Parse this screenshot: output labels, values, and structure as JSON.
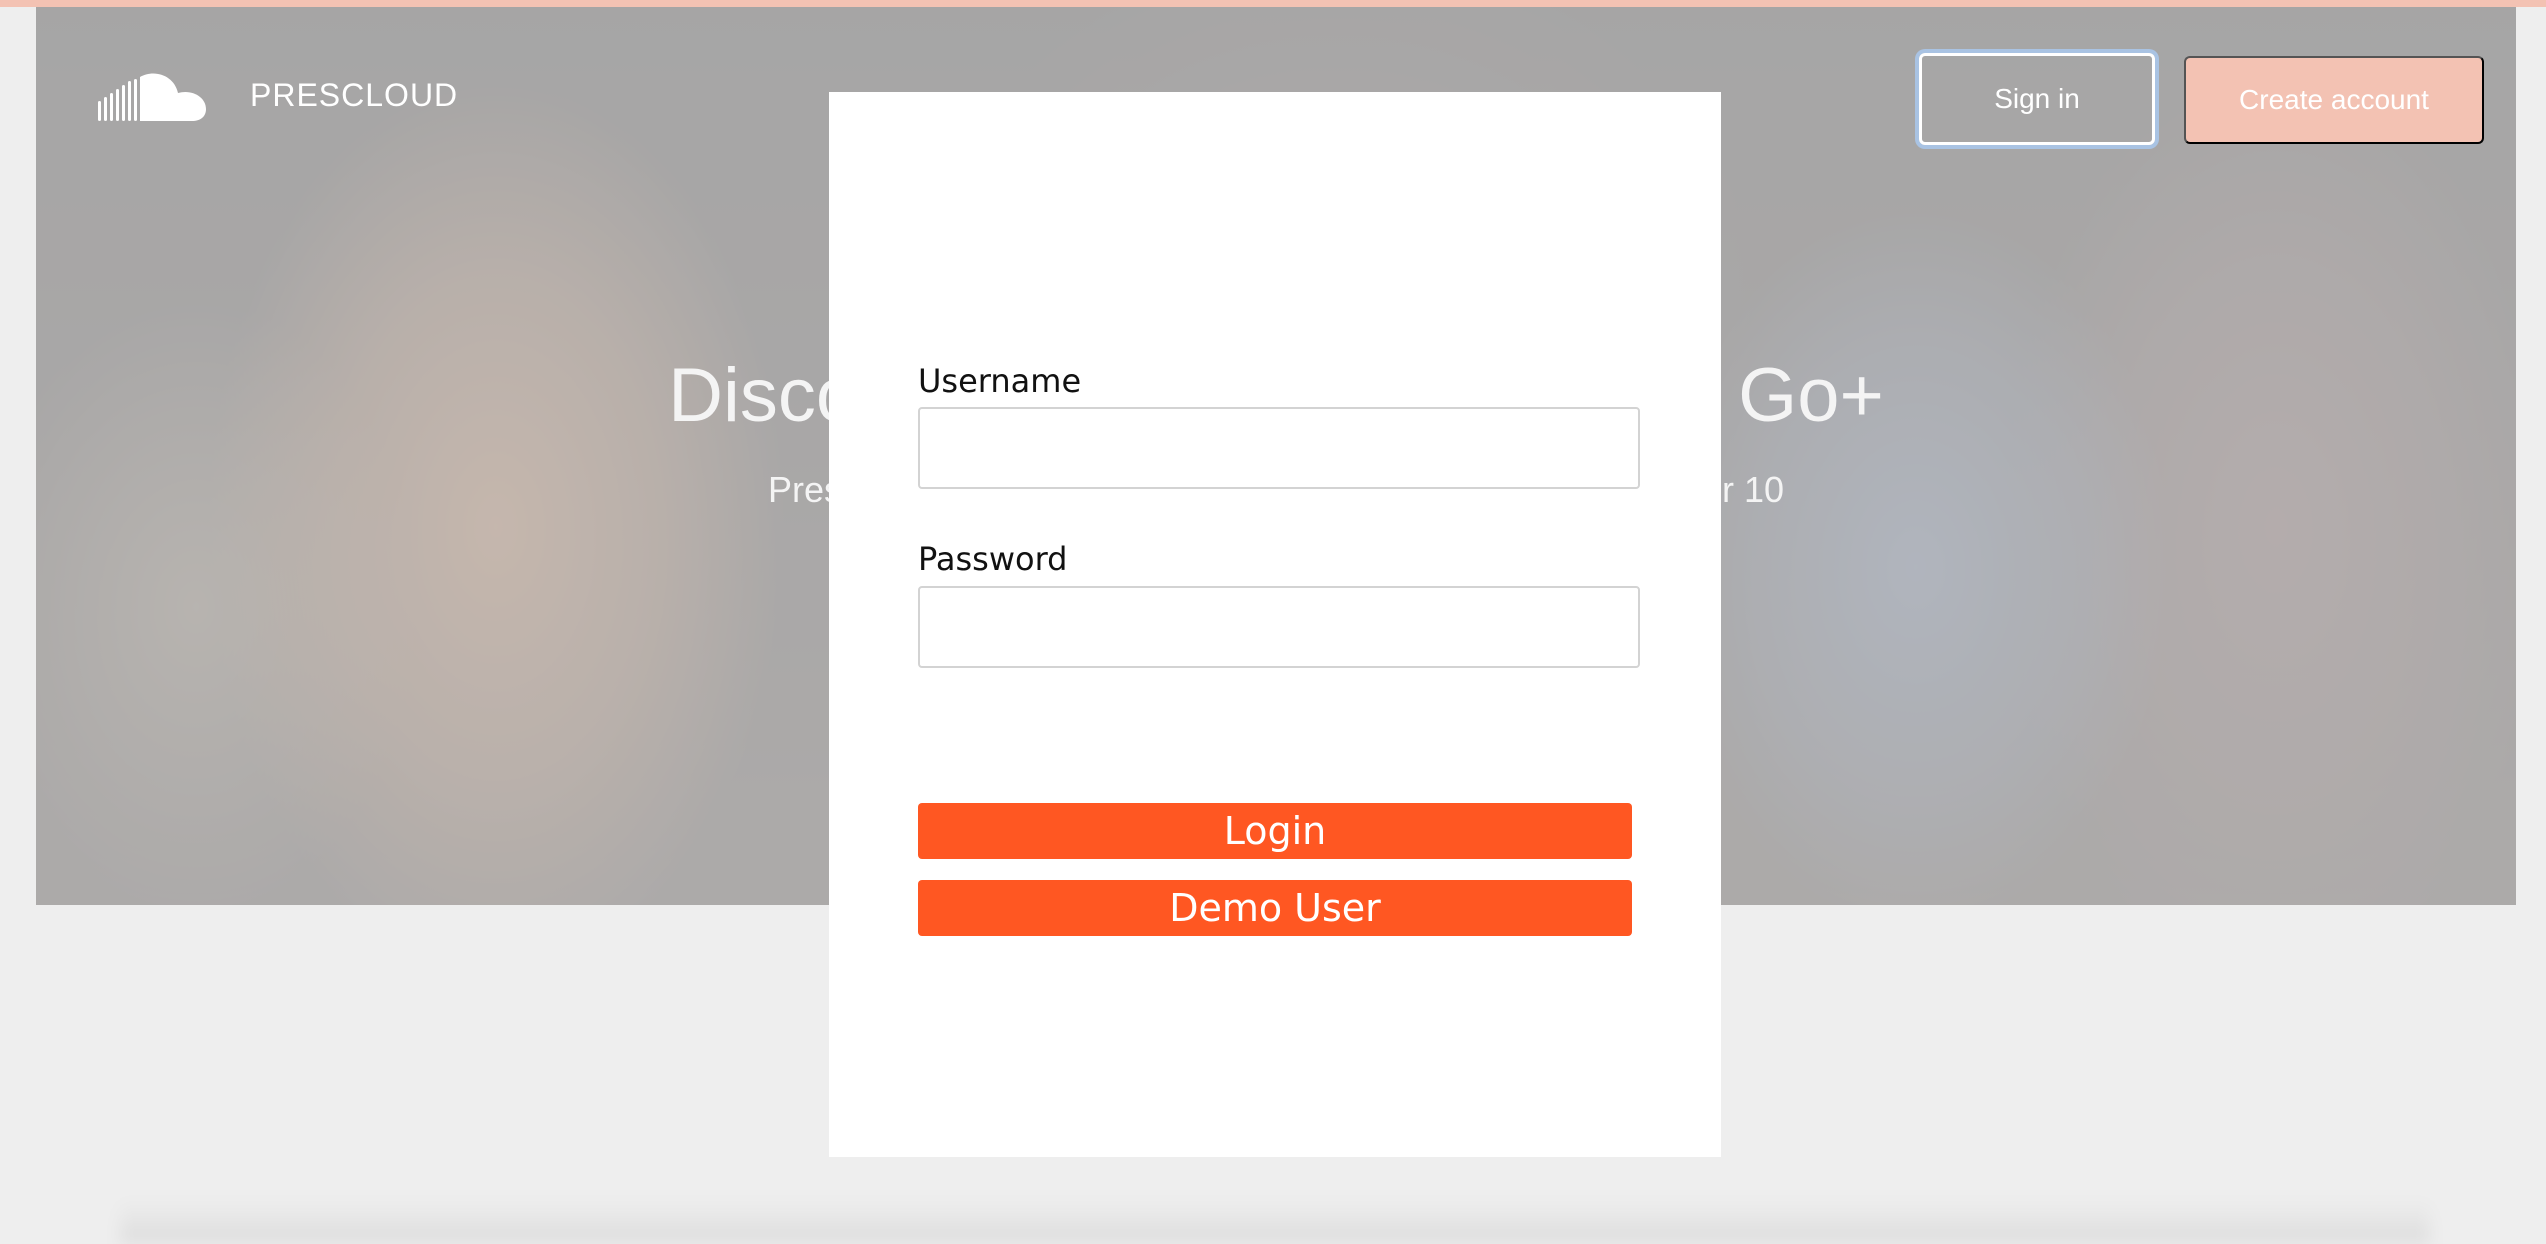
{
  "colors": {
    "accent": "#ff5722",
    "create_account_bg": "#f3c2b3",
    "overlay": "#cdcdcd",
    "page_bg": "#eeeeee"
  },
  "nav": {
    "logo_icon": "soundcloud-cloud-icon",
    "brand": "PRESCLOUD",
    "sign_in_label": "Sign in",
    "create_account_label": "Create account"
  },
  "hero": {
    "title_left": "Disco",
    "title_right": "Go+",
    "subtitle_left": "Pres",
    "subtitle_right": "r 10"
  },
  "login_modal": {
    "username_label": "Username",
    "username_value": "",
    "password_label": "Password",
    "password_value": "",
    "login_label": "Login",
    "demo_label": "Demo User"
  }
}
